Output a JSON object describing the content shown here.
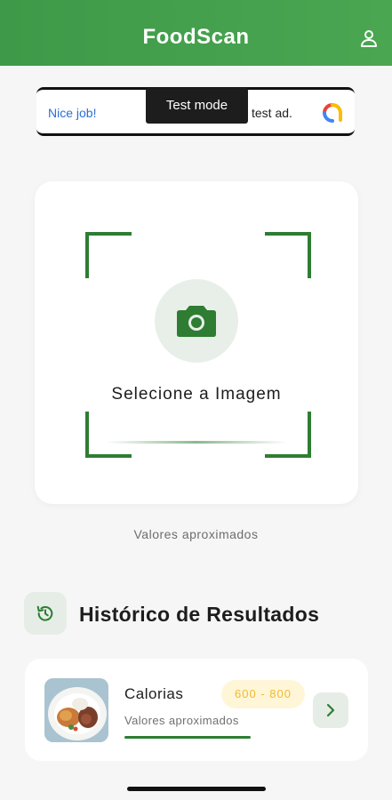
{
  "header": {
    "title": "FoodScan",
    "profile_icon": "user-icon"
  },
  "ad": {
    "left_text": "Nice job!",
    "badge_text": "Test mode",
    "right_text": "test ad.",
    "logo_icon": "ad-logo-icon"
  },
  "scan": {
    "label": "Selecione a Imagem",
    "camera_icon": "camera-icon",
    "note": "Valores aproximados"
  },
  "history": {
    "title": "Histórico de Resultados",
    "icon": "history-icon",
    "items": [
      {
        "label": "Calorias",
        "range": "600 - 800",
        "note": "Valores aproximados",
        "thumbnail": "food-plate-image"
      }
    ]
  },
  "colors": {
    "primary": "#3e9a48",
    "accent_dark": "#2e7d32",
    "badge_text": "#f2b92f",
    "badge_bg": "#fff6d8"
  }
}
